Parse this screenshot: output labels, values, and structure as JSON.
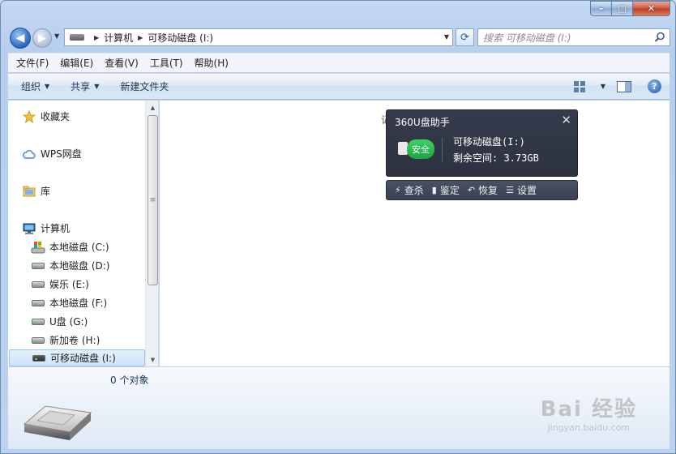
{
  "window": {
    "caption": {
      "minimize": "–",
      "maximize": "□",
      "close": "✕"
    }
  },
  "nav": {
    "back": "◀",
    "forward": "▶",
    "breadcrumb": [
      "计算机",
      "可移动磁盘 (I:)"
    ],
    "refresh": "⟳",
    "search_placeholder": "搜索 可移动磁盘 (I:)"
  },
  "menubar": [
    "文件(F)",
    "编辑(E)",
    "查看(V)",
    "工具(T)",
    "帮助(H)"
  ],
  "cmdbar": {
    "organize": "组织",
    "share": "共享",
    "new_folder": "新建文件夹",
    "help": "?"
  },
  "sidebar": {
    "favorites": "收藏夹",
    "wps": "WPS网盘",
    "library": "库",
    "computer": "计算机",
    "drives": [
      "本地磁盘 (C:)",
      "本地磁盘 (D:)",
      "娱乐 (E:)",
      "本地磁盘 (F:)",
      "U盘 (G:)",
      "新加卷 (H:)",
      "可移动磁盘 (I:)"
    ],
    "selected_drive": "可移动磁盘 (I:)",
    "scroll_grip": "≡"
  },
  "main": {
    "partial_text": "记"
  },
  "popup360": {
    "title": "360U盘助手",
    "close": "✕",
    "status": "安全",
    "drive": "可移动磁盘(I:)",
    "free_space": "剩余空间: 3.73GB",
    "actions": [
      "查杀",
      "鉴定",
      "恢复",
      "设置"
    ]
  },
  "details": {
    "object_count": "0 个对象"
  },
  "watermark": {
    "brand": "Bai 经验",
    "url": "jingyan.baidu.com"
  }
}
